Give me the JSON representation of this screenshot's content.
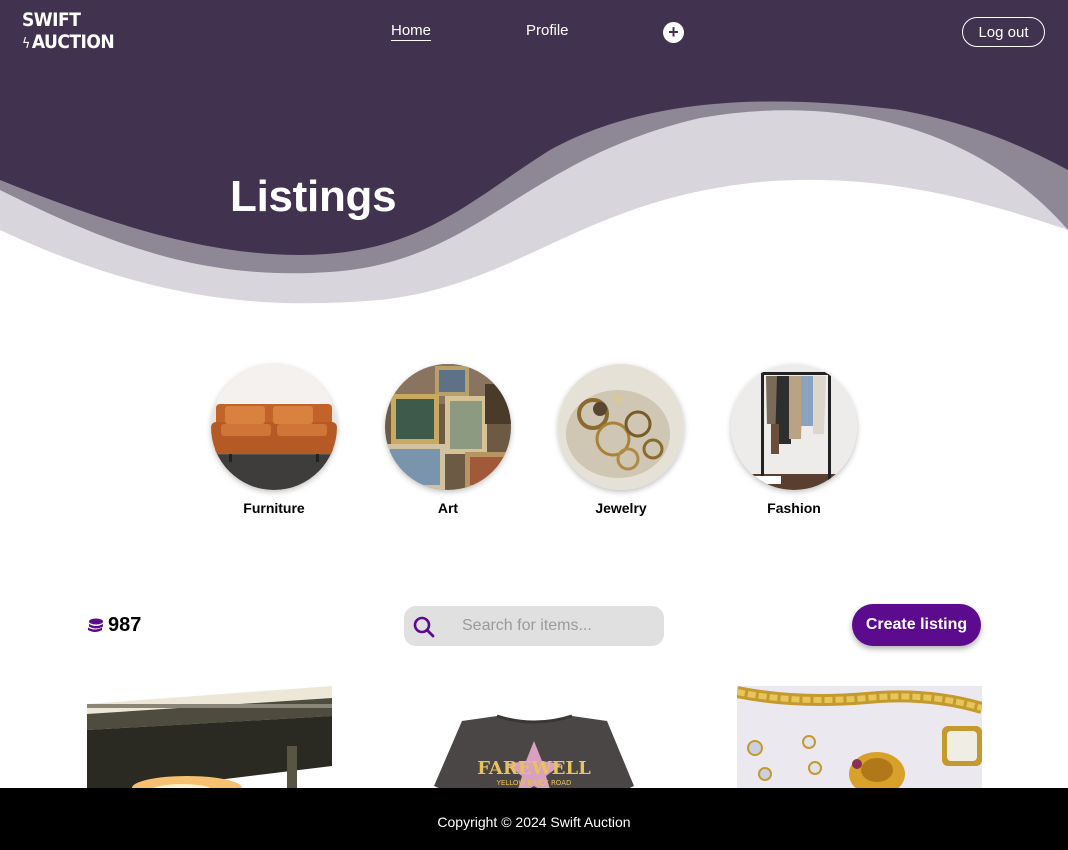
{
  "nav": {
    "logo_line1": "SWIFT",
    "logo_line2": "AUCTION",
    "links": [
      {
        "label": "Home"
      },
      {
        "label": "Profile"
      }
    ],
    "add_icon": "plus-circle-icon",
    "logout_label": "Log out"
  },
  "hero": {
    "title": "Listings"
  },
  "categories": [
    {
      "label": "Furniture"
    },
    {
      "label": "Art"
    },
    {
      "label": "Jewelry"
    },
    {
      "label": "Fashion"
    }
  ],
  "toolbar": {
    "credits_icon": "coins-stack-icon",
    "credits": "987",
    "search_placeholder": "Search for items...",
    "create_label": "Create listing"
  },
  "footer": {
    "copyright": "Copyright © 2024 Swift Auction"
  },
  "colors": {
    "nav_bg": "#41334f",
    "accent": "#5c0a8e",
    "wave_mid": "#8e8896",
    "wave_light": "#d8d6dc",
    "footer_bg": "#000000"
  }
}
